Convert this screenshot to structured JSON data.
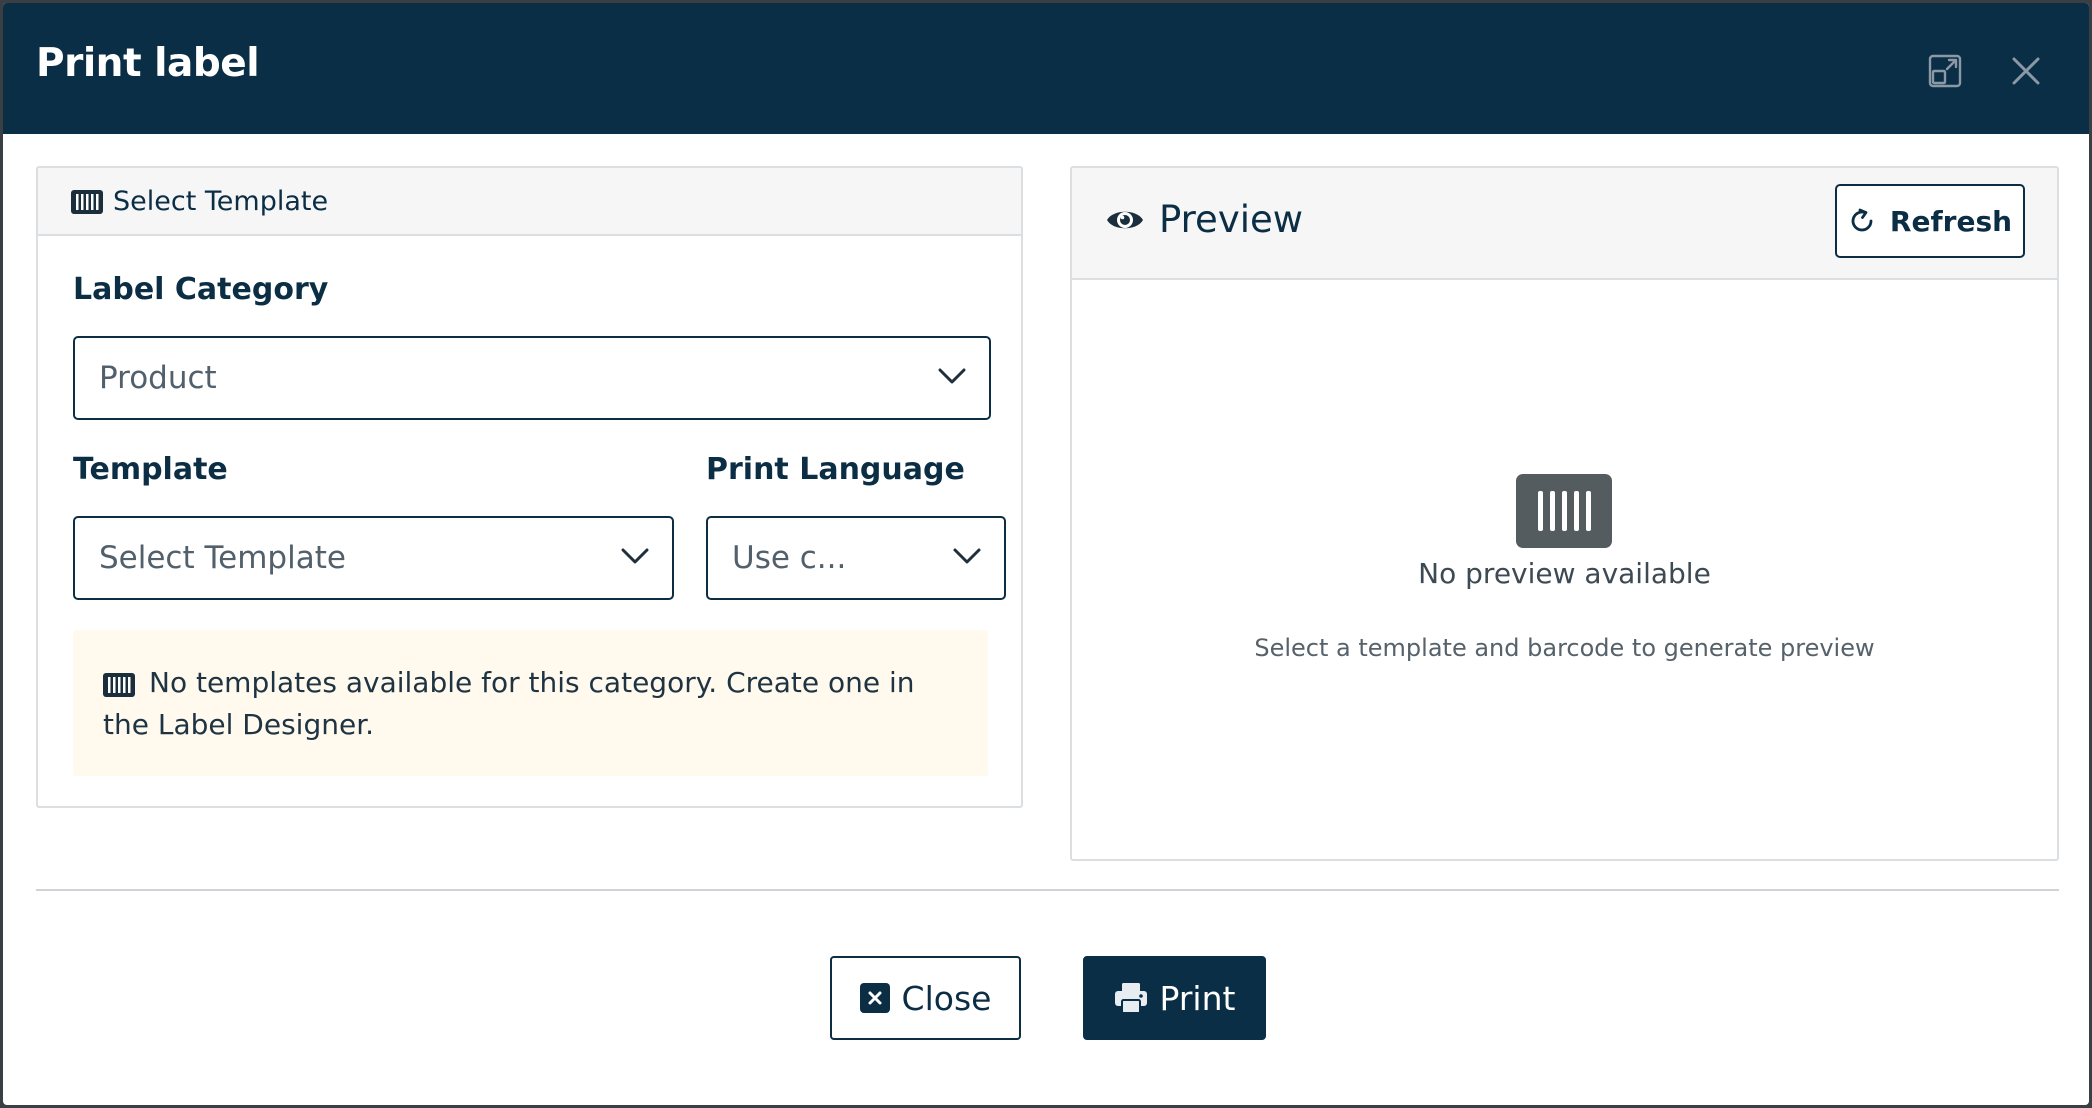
{
  "modal": {
    "title": "Print label"
  },
  "template_card": {
    "title": "Select Template",
    "label_category": {
      "label": "Label Category",
      "value": "Product"
    },
    "template": {
      "label": "Template",
      "value": "Select Template"
    },
    "print_language": {
      "label": "Print Language",
      "value": "Use c..."
    },
    "notice": "No templates available for this category. Create one in the Label Designer."
  },
  "preview_card": {
    "title": "Preview",
    "refresh_label": "Refresh",
    "empty_title": "No preview available",
    "empty_subtitle": "Select a template and barcode to generate preview"
  },
  "footer": {
    "close_label": "Close",
    "print_label": "Print"
  },
  "colors": {
    "primary": "#0a2e45",
    "notice_bg": "#fff9ee",
    "card_header_bg": "#f6f6f7",
    "border": "#dcdfe2"
  }
}
